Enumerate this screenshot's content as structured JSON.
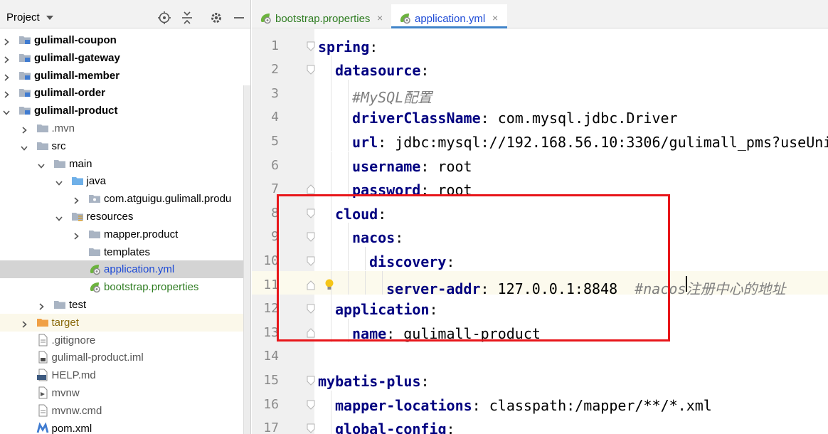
{
  "project_panel": {
    "title": "Project",
    "header_icons": [
      "locate-icon",
      "collapse-all-icon",
      "gear-icon",
      "minimize-icon"
    ],
    "tree": [
      {
        "label": "gulimall-coupon",
        "icon": "module-folder-icon",
        "arrow": "right",
        "style": "bold"
      },
      {
        "label": "gulimall-gateway",
        "icon": "module-folder-icon",
        "arrow": "right",
        "style": "bold"
      },
      {
        "label": "gulimall-member",
        "icon": "module-folder-icon",
        "arrow": "right",
        "style": "bold"
      },
      {
        "label": "gulimall-order",
        "icon": "module-folder-icon",
        "arrow": "right",
        "style": "bold"
      },
      {
        "label": "gulimall-product",
        "icon": "module-folder-icon",
        "arrow": "down",
        "style": "bold"
      },
      {
        "label": ".mvn",
        "icon": "folder-icon",
        "arrow": "right",
        "style": "gray"
      },
      {
        "label": "src",
        "icon": "folder-icon",
        "arrow": "down",
        "style": "normal"
      },
      {
        "label": "main",
        "icon": "folder-icon",
        "arrow": "down",
        "style": "normal"
      },
      {
        "label": "java",
        "icon": "source-folder-icon",
        "arrow": "down",
        "style": "normal"
      },
      {
        "label": "com.atguigu.gulimall.produ",
        "icon": "package-icon",
        "arrow": "right",
        "style": "normal"
      },
      {
        "label": "resources",
        "icon": "resources-folder-icon",
        "arrow": "down",
        "style": "normal"
      },
      {
        "label": "mapper.product",
        "icon": "folder-icon",
        "arrow": "right",
        "style": "normal"
      },
      {
        "label": "templates",
        "icon": "folder-icon",
        "arrow": "none",
        "style": "normal"
      },
      {
        "label": "application.yml",
        "icon": "spring-config-icon",
        "arrow": "none",
        "style": "blue",
        "selected": true
      },
      {
        "label": "bootstrap.properties",
        "icon": "spring-config-icon",
        "arrow": "none",
        "style": "green"
      },
      {
        "label": "test",
        "icon": "folder-icon",
        "arrow": "right",
        "style": "normal"
      },
      {
        "label": "target",
        "icon": "excluded-folder-icon",
        "arrow": "right",
        "style": "olive",
        "highlighted": true
      },
      {
        "label": ".gitignore",
        "icon": "text-file-icon",
        "arrow": "none",
        "style": "gray"
      },
      {
        "label": "gulimall-product.iml",
        "icon": "iml-file-icon",
        "arrow": "none",
        "style": "gray"
      },
      {
        "label": "HELP.md",
        "icon": "markdown-file-icon",
        "arrow": "none",
        "style": "gray"
      },
      {
        "label": "mvnw",
        "icon": "script-file-icon",
        "arrow": "none",
        "style": "gray"
      },
      {
        "label": "mvnw.cmd",
        "icon": "text-file-icon",
        "arrow": "none",
        "style": "gray"
      },
      {
        "label": "pom.xml",
        "icon": "maven-icon",
        "arrow": "none",
        "style": "normal"
      }
    ]
  },
  "tabs": [
    {
      "label": "bootstrap.properties",
      "icon": "spring-config-icon",
      "active": false,
      "color": "#2f7d22"
    },
    {
      "label": "application.yml",
      "icon": "spring-config-icon",
      "active": true,
      "color": "#1e4bd6"
    }
  ],
  "editor": {
    "lines": [
      {
        "n": "1",
        "indent": 0,
        "key": "spring",
        "value": "",
        "comment": ""
      },
      {
        "n": "2",
        "indent": 1,
        "key": "datasource",
        "value": "",
        "comment": ""
      },
      {
        "n": "3",
        "indent": 2,
        "key": "",
        "value": "",
        "comment": "#MySQL配置"
      },
      {
        "n": "4",
        "indent": 2,
        "key": "driverClassName",
        "value": "com.mysql.jdbc.Driver",
        "comment": ""
      },
      {
        "n": "5",
        "indent": 2,
        "key": "url",
        "value": "jdbc:mysql://192.168.56.10:3306/gulimall_pms?useUni",
        "comment": ""
      },
      {
        "n": "6",
        "indent": 2,
        "key": "username",
        "value": "root",
        "comment": ""
      },
      {
        "n": "7",
        "indent": 2,
        "key": "password",
        "value": "root",
        "comment": ""
      },
      {
        "n": "8",
        "indent": 1,
        "key": "cloud",
        "value": "",
        "comment": ""
      },
      {
        "n": "9",
        "indent": 2,
        "key": "nacos",
        "value": "",
        "comment": ""
      },
      {
        "n": "10",
        "indent": 3,
        "key": "discovery",
        "value": "",
        "comment": ""
      },
      {
        "n": "11",
        "indent": 4,
        "key": "server-addr",
        "value": "127.0.0.1:8848",
        "comment": "#nacos注册中心的地址",
        "current": true
      },
      {
        "n": "12",
        "indent": 1,
        "key": "application",
        "value": "",
        "comment": ""
      },
      {
        "n": "13",
        "indent": 2,
        "key": "name",
        "value": "gulimall-product",
        "comment": ""
      },
      {
        "n": "14",
        "indent": 0,
        "key": "",
        "value": "",
        "comment": ""
      },
      {
        "n": "15",
        "indent": 0,
        "key": "mybatis-plus",
        "value": "",
        "comment": ""
      },
      {
        "n": "16",
        "indent": 1,
        "key": "mapper-locations",
        "value": "classpath:/mapper/**/*.xml",
        "comment": ""
      },
      {
        "n": "17",
        "indent": 1,
        "key": "global-config",
        "value": "",
        "comment": ""
      }
    ]
  },
  "colors": {
    "highlight_box": "#e8161a",
    "key": "#000080",
    "comment": "#808080",
    "selection": "#d4d4d4"
  }
}
